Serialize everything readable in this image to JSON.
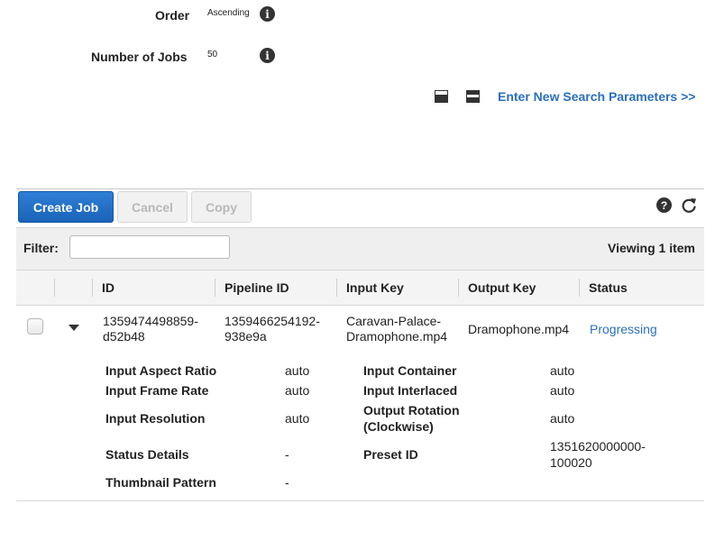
{
  "search": {
    "order_label": "Order",
    "order_value": "Ascending",
    "jobs_label": "Number of Jobs",
    "jobs_value": "50",
    "new_search_link": "Enter New Search Parameters >>"
  },
  "toolbar": {
    "create_label": "Create Job",
    "cancel_label": "Cancel",
    "copy_label": "Copy",
    "help_icon": "help-icon",
    "refresh_icon": "refresh-icon"
  },
  "filter": {
    "label": "Filter:",
    "value": "",
    "viewing": "Viewing 1 item"
  },
  "table": {
    "columns": [
      "ID",
      "Pipeline ID",
      "Input Key",
      "Output Key",
      "Status"
    ],
    "row": {
      "id": "1359474498859-\nd52b48",
      "pipeline_id": "1359466254192-\n938e9a",
      "input_key": "Caravan-Palace-\nDramophone.mp4",
      "output_key": "Dramophone.mp4",
      "status": "Progressing"
    }
  },
  "details": {
    "left": [
      {
        "label": "Input Aspect Ratio",
        "value": "auto"
      },
      {
        "label": "Input Frame Rate",
        "value": "auto"
      },
      {
        "label": "Input Resolution",
        "value": "auto"
      },
      {
        "label": "Status Details",
        "value": "-"
      },
      {
        "label": "Thumbnail Pattern",
        "value": "-"
      }
    ],
    "right": [
      {
        "label": "Input Container",
        "value": "auto"
      },
      {
        "label": "Input Interlaced",
        "value": "auto"
      },
      {
        "label": "Output Rotation\n(Clockwise)",
        "value": "auto"
      },
      {
        "label": "Preset ID",
        "value": "1351620000000-\n100020"
      }
    ]
  },
  "colors": {
    "accent": "#2a6fc0",
    "primary_button": "#1a63b8"
  }
}
